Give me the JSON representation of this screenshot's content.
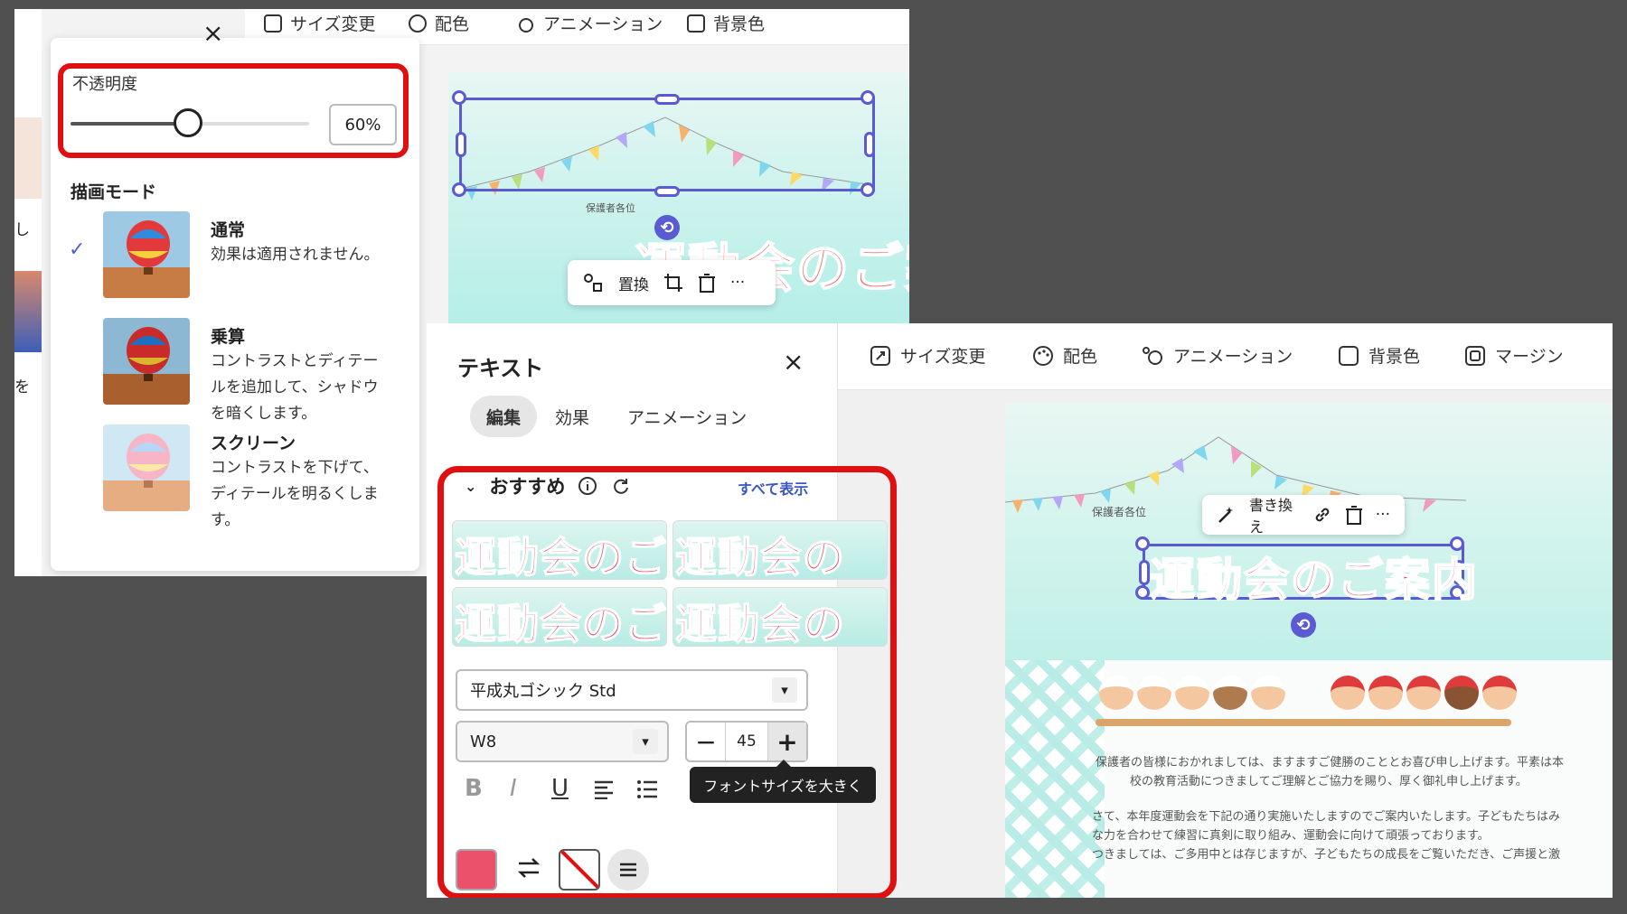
{
  "panel_a": {
    "topbar": {
      "items": [
        "サイズ変更",
        "配色",
        "アニメーション",
        "背景色"
      ]
    },
    "close_glyph": "×",
    "opacity": {
      "label": "不透明度",
      "value": 0.6,
      "display": "60%"
    },
    "blend": {
      "heading": "描画モード",
      "modes": [
        {
          "title": "通常",
          "desc": "効果は適用されません。",
          "selected": true
        },
        {
          "title": "乗算",
          "desc": "コントラストとディテールを追加して、シャドウを暗くします。",
          "selected": false
        },
        {
          "title": "スクリーン",
          "desc": "コントラストを下げて、ディテールを明るくします。",
          "selected": false
        }
      ]
    },
    "left_edge_fragments": [
      "し",
      "を"
    ],
    "canvas": {
      "addressee": "保護者各位",
      "title_fragment": "運動会のご案",
      "toolbar": {
        "replace": "置換"
      }
    }
  },
  "panel_b": {
    "sidebar": {
      "title": "テキスト",
      "close": "×",
      "tabs": [
        {
          "label": "編集",
          "active": true
        },
        {
          "label": "効果",
          "active": false
        },
        {
          "label": "アニメーション",
          "active": false
        }
      ],
      "recommended": {
        "label": "おすすめ",
        "see_all": "すべて表示",
        "presets": [
          "運動会のご",
          "運動会の",
          "運動会のご",
          "運動会の"
        ]
      },
      "font": {
        "family": "平成丸ゴシック Std",
        "weight": "W8",
        "size": "45"
      },
      "format": {
        "bold": "B",
        "italic": "I",
        "underline": "U"
      },
      "tooltip": "フォントサイズを大きく",
      "text_color": "#ec516c"
    },
    "topbar": {
      "items": [
        "サイズ変更",
        "配色",
        "アニメーション",
        "背景色",
        "マージン"
      ]
    },
    "canvas": {
      "addressee": "保護者各位",
      "title": "運動会のご案内",
      "toolbar": {
        "rewrite": "書き換え"
      },
      "body": [
        "保護者の皆様におかれましては、ますますご健勝のこととお喜び申し上げます。平素は本",
        "校の教育活動につきましてご理解とご協力を賜り、厚く御礼申し上げます。",
        "さて、本年度運動会を下記の通り実施いたしますのでご案内いたします。子どもたちはみ",
        "な力を合わせて練習に真剣に取り組み、運動会に向けて頑張っております。",
        "つきましては、ご多用中とは存じますが、子どもたちの成長をご覧いただき、ご声援と激"
      ]
    }
  },
  "colors": {
    "highlight_red": "#e11010",
    "selection_blue": "#5a5ad2",
    "title_pink": "#ec516c",
    "link_blue": "#3b55c8"
  }
}
